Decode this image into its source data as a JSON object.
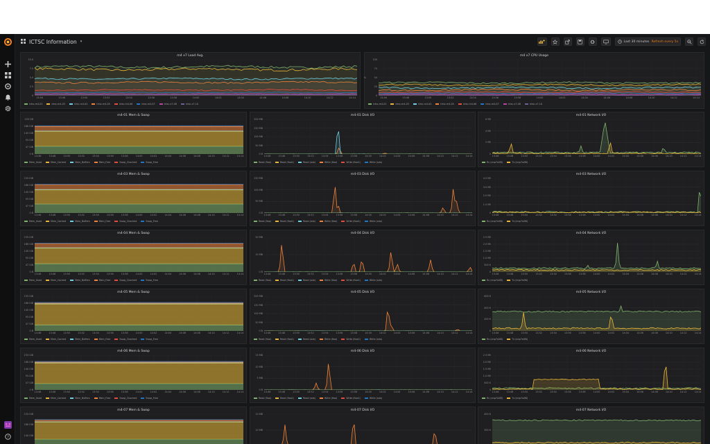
{
  "dashboard": {
    "title": "ICTSC Information"
  },
  "toolbar": {
    "time_range": "Last 30 minutes",
    "refresh": "Refresh every 5s"
  },
  "icons": {
    "logo": "grafana-logo-icon",
    "side": [
      "plus-icon",
      "dashboards-icon",
      "explore-icon",
      "alerts-icon",
      "gear-icon",
      "avatar-icon",
      "help-icon"
    ],
    "toolbar": [
      "add-panel-icon",
      "star-icon",
      "share-icon",
      "save-icon",
      "settings-icon",
      "tv-mode-icon",
      "clock-icon",
      "zoom-out-icon",
      "refresh-icon"
    ]
  },
  "time_ticks": [
    "13:46",
    "13:48",
    "13:50",
    "13:52",
    "13:54",
    "13:56",
    "13:58",
    "14:00",
    "14:02",
    "14:04",
    "14:06",
    "14:08",
    "14:10",
    "14:12",
    "14:14"
  ],
  "colors": {
    "green": "#7eb26d",
    "yellow": "#eab839",
    "cyan": "#6ed0e0",
    "orange": "#ef843c",
    "red": "#e24d42",
    "blue": "#1f78c1",
    "purple": "#ba43a9",
    "dkgreen": "#508642",
    "dkyellow": "#cca300",
    "dkblue": "#447ebc"
  },
  "panels": [
    {
      "id": "load",
      "title": "m4 x7 Load Avg.",
      "y_ticks": [
        "10.0",
        "7.5",
        "5.0",
        "2.5",
        "0"
      ],
      "chart_data": {
        "type": "line",
        "ylim": [
          0,
          10
        ],
        "x": "time_ticks",
        "series": [
          {
            "name": "ictsc-m4-01",
            "color": "#7eb26d",
            "level": 8.0,
            "noise": 0.3
          },
          {
            "name": "ictsc-m4-03",
            "color": "#eab839",
            "level": 7.3,
            "noise": 0.3
          },
          {
            "name": "ictsc-m4-04",
            "color": "#6ed0e0",
            "level": 4.7,
            "noise": 0.2
          },
          {
            "name": "ictsc-m4-05",
            "color": "#ef843c",
            "level": 3.7,
            "noise": 0.2
          },
          {
            "name": "ictsc-m4-06",
            "color": "#e24d42",
            "level": 1.6,
            "noise": 0.15
          },
          {
            "name": "ictsc-m4-07",
            "color": "#1f78c1",
            "level": 0.9,
            "noise": 0.1
          },
          {
            "name": "ictsc-x7-08",
            "color": "#ba43a9",
            "level": 0.5,
            "noise": 0.1
          },
          {
            "name": "ictsc-x7-10",
            "color": "#705da0",
            "level": 0.3,
            "noise": 0.05
          }
        ]
      }
    },
    {
      "id": "cpu",
      "title": "m4 x7 CPU Usage",
      "y_ticks": [
        "100",
        "75",
        "50",
        "25",
        "0"
      ],
      "y_unit": "%",
      "chart_data": {
        "type": "line",
        "ylim": [
          0,
          100
        ],
        "x": "time_ticks",
        "series": [
          {
            "name": "ictsc-m4-01",
            "color": "#7eb26d",
            "level": 36,
            "noise": 2
          },
          {
            "name": "ictsc-m4-03",
            "color": "#eab839",
            "level": 30,
            "noise": 2
          },
          {
            "name": "ictsc-m4-04",
            "color": "#6ed0e0",
            "level": 22,
            "noise": 2
          },
          {
            "name": "ictsc-m4-05",
            "color": "#ef843c",
            "level": 16,
            "noise": 2
          },
          {
            "name": "ictsc-m4-06",
            "color": "#e24d42",
            "level": 10,
            "noise": 1
          },
          {
            "name": "ictsc-m4-07",
            "color": "#1f78c1",
            "level": 7,
            "noise": 1
          },
          {
            "name": "ictsc-x7-08",
            "color": "#ba43a9",
            "level": 4,
            "noise": 1
          },
          {
            "name": "ictsc-x7-10",
            "color": "#705da0",
            "level": 2,
            "noise": 1
          }
        ]
      }
    },
    {
      "id": "mem01",
      "title": "m4-01 Mem & Swap",
      "kind": "mem",
      "y_ticks": [
        "233 GB",
        "186 GiB",
        "140 GiB",
        "93 GiB",
        "47 GiB",
        "0 B"
      ],
      "legend": [
        "Mem_Used",
        "Mem_Cached",
        "Mem_Buffers",
        "Mem_Free",
        "Swap_Chached",
        "Swap_Free"
      ],
      "chart_data": {
        "type": "area",
        "ylim": [
          0,
          233
        ],
        "stacked": true,
        "values": {
          "Mem_Used": 52,
          "Mem_Cached": 100,
          "Mem_Buffers": 3,
          "Mem_Free": 30
        }
      }
    },
    {
      "id": "disk01",
      "title": "m4-01 Disk I/O",
      "kind": "disk",
      "y_ticks": [
        "200 MB",
        "150 MB",
        "100 MB",
        "50 MB",
        "0 B"
      ],
      "legend": [
        "Read (fioa)",
        "Read (fioa1)",
        "Read (sda)",
        "Write (fioa)",
        "Write (fioa1)",
        "Write (sda)"
      ],
      "chart_data": {
        "type": "line",
        "ylim": [
          0,
          200
        ],
        "spikes": [
          {
            "t": 0.355,
            "v": 180,
            "color": "#6ed0e0"
          },
          {
            "t": 0.36,
            "v": 40,
            "color": "#ef843c"
          },
          {
            "t": 0.58,
            "v": 6,
            "color": "#ef843c"
          }
        ]
      }
    },
    {
      "id": "net01",
      "title": "m4-01 Network I/O",
      "kind": "net",
      "y_ticks": [
        "6 Mil",
        "4 Mil",
        "2 Mil",
        "0"
      ],
      "legend": [
        "Rx (enp7s0f0)",
        "Tx (enp7s0f0)"
      ],
      "chart_data": {
        "type": "area",
        "ylim": [
          0,
          6
        ],
        "base": [
          0.2,
          0.05
        ],
        "spikes": [
          {
            "t": 0.09,
            "v": 2.0,
            "color": "#eab839"
          },
          {
            "t": 0.425,
            "v": 1.4,
            "color": "#7eb26d"
          },
          {
            "t": 0.54,
            "v": 5.8,
            "color": "#7eb26d",
            "width": 0.025
          },
          {
            "t": 0.565,
            "v": 2.2,
            "color": "#eab839"
          },
          {
            "t": 0.82,
            "v": 1.3,
            "color": "#7eb26d"
          }
        ]
      }
    },
    {
      "id": "mem03",
      "title": "m4-03 Mem & Swap",
      "kind": "mem",
      "y_ticks": [
        "233 GiB",
        "186 GiB",
        "140 GiB",
        "93 GiB",
        "47 GiB",
        "0 B"
      ],
      "legend": [
        "Mem_Used",
        "Mem_Cached",
        "Mem_Buffers",
        "Mem_Free",
        "Swap_Chached",
        "Swap_Free"
      ],
      "chart_data": {
        "type": "area",
        "ylim": [
          0,
          233
        ],
        "stacked": true,
        "values": {
          "Mem_Used": 60,
          "Mem_Cached": 95,
          "Mem_Buffers": 3,
          "Mem_Free": 30
        }
      }
    },
    {
      "id": "disk03",
      "title": "m4-03 Disk I/O",
      "kind": "disk",
      "y_ticks": [
        "150 MB",
        "100 MB",
        "50 MB",
        "0 B"
      ],
      "legend": [
        "Read (fioa)",
        "Read (fioa1)",
        "Read (sda)",
        "Write (fioa)",
        "Write (fioa1)",
        "Write (sda)"
      ],
      "chart_data": {
        "type": "line",
        "ylim": [
          0,
          150
        ],
        "spikes": [
          {
            "t": 0.34,
            "v": 130,
            "color": "#ef843c"
          },
          {
            "t": 0.355,
            "v": 40,
            "color": "#ef843c"
          },
          {
            "t": 0.86,
            "v": 25,
            "color": "#ef843c"
          },
          {
            "t": 0.91,
            "v": 120,
            "color": "#ef843c"
          },
          {
            "t": 0.925,
            "v": 50,
            "color": "#ef843c"
          }
        ]
      }
    },
    {
      "id": "net03",
      "title": "m4-03 Network I/O",
      "kind": "net",
      "y_ticks": [
        "4.0 Mil",
        "3.0 Mil",
        "2.0 Mil",
        "1.0 Mil",
        "0"
      ],
      "legend": [
        "Rx (enp7s0f0)",
        "Tx (enp7s0f0)"
      ],
      "chart_data": {
        "type": "line",
        "ylim": [
          0,
          4
        ],
        "base": [
          0.08,
          0.05
        ],
        "spikes": [
          {
            "t": 0.995,
            "v": 3.3,
            "color": "#7eb26d"
          }
        ]
      }
    },
    {
      "id": "mem04",
      "title": "m4-04 Mem & Swap",
      "kind": "mem",
      "y_ticks": [
        "233 GiB",
        "186 GiB",
        "140 GiB",
        "93 GiB",
        "47 GiB",
        "0 B"
      ],
      "legend": [
        "Mem_Used",
        "Mem_Cached",
        "Mem_Buffers",
        "Mem_Free",
        "Swap_Chached",
        "Swap_Free"
      ],
      "chart_data": {
        "type": "area",
        "ylim": [
          0,
          233
        ],
        "stacked": true,
        "values": {
          "Mem_Used": 55,
          "Mem_Cached": 105,
          "Mem_Buffers": 3,
          "Mem_Free": 25
        }
      }
    },
    {
      "id": "disk04",
      "title": "m4-04 Disk I/O",
      "kind": "disk",
      "y_ticks": [
        "20 MB",
        "10 MB",
        "0 B"
      ],
      "legend": [
        "Read (fioa)",
        "Read (fioa1)",
        "Read (sda)",
        "Write (fioa)",
        "Write (fioa1)",
        "Write (sda)"
      ],
      "chart_data": {
        "type": "line",
        "ylim": [
          0,
          20
        ],
        "spikes": [
          {
            "t": 0.085,
            "v": 18,
            "color": "#ef843c"
          },
          {
            "t": 0.43,
            "v": 6,
            "color": "#ef843c"
          },
          {
            "t": 0.47,
            "v": 8,
            "color": "#ef843c"
          },
          {
            "t": 0.61,
            "v": 13,
            "color": "#ef843c"
          },
          {
            "t": 0.64,
            "v": 5,
            "color": "#ef843c"
          },
          {
            "t": 0.8,
            "v": 7,
            "color": "#ef843c"
          },
          {
            "t": 0.99,
            "v": 3,
            "color": "#ef843c"
          }
        ]
      }
    },
    {
      "id": "net04",
      "title": "m4-04 Network I/O",
      "kind": "net",
      "y_ticks": [
        "2.5 Mil",
        "2.0 Mil",
        "1.5 Mil",
        "1.0 Mil",
        "500 K",
        "0"
      ],
      "legend": [
        "Rx (enp7s0f0)",
        "Tx (enp7s0f0)"
      ],
      "chart_data": {
        "type": "area",
        "ylim": [
          0,
          2.5
        ],
        "base": [
          0.25,
          0.12
        ],
        "spikes": [
          {
            "t": 0.6,
            "v": 2.1,
            "color": "#7eb26d"
          },
          {
            "t": 0.79,
            "v": 0.9,
            "color": "#7eb26d"
          },
          {
            "t": 0.46,
            "v": 0.55,
            "color": "#7eb26d"
          }
        ]
      }
    },
    {
      "id": "mem05",
      "title": "m4-05 Mem & Swap",
      "kind": "mem",
      "y_ticks": [
        "233 GiB",
        "186 GiB",
        "140 GiB",
        "93 GiB",
        "47 GiB",
        "0 B"
      ],
      "legend": [
        "Mem_Used",
        "Mem_Cached",
        "Mem_Buffers",
        "Mem_Free",
        "Swap_Chached",
        "Swap_Free"
      ],
      "chart_data": {
        "type": "area",
        "ylim": [
          0,
          233
        ],
        "stacked": true,
        "values": {
          "Mem_Used": 40,
          "Mem_Cached": 140,
          "Mem_Buffers": 3,
          "Mem_Free": 3
        }
      }
    },
    {
      "id": "disk05",
      "title": "m4-05 Disk I/O",
      "kind": "disk",
      "y_ticks": [
        "200 MB",
        "150 MB",
        "100 MB",
        "50 MB",
        "0 B"
      ],
      "legend": [
        "Read (fioa)",
        "Read (fioa1)",
        "Read (sda)",
        "Write (fioa)",
        "Write (fioa1)",
        "Write (sda)"
      ],
      "chart_data": {
        "type": "line",
        "ylim": [
          0,
          200
        ],
        "spikes": [
          {
            "t": 0.595,
            "v": 150,
            "color": "#ef843c"
          },
          {
            "t": 0.61,
            "v": 40,
            "color": "#ef843c"
          },
          {
            "t": 0.93,
            "v": 10,
            "color": "#ef843c"
          }
        ]
      }
    },
    {
      "id": "net05",
      "title": "m4-05 Network I/O",
      "kind": "net",
      "y_ticks": [
        "600 K",
        "400 K",
        "200 K",
        "0"
      ],
      "legend": [
        "Rx (enp7s0f0)",
        "Tx (enp7s0f0)"
      ],
      "chart_data": {
        "type": "area",
        "ylim": [
          0,
          600
        ],
        "base": [
          330,
          40
        ],
        "spikes": [
          {
            "t": 0.15,
            "v": 320,
            "color": "#eab839"
          },
          {
            "t": 0.57,
            "v": 330,
            "color": "#eab839"
          },
          {
            "t": 0.615,
            "v": 500,
            "color": "#7eb26d"
          },
          {
            "t": 0.72,
            "v": 430,
            "color": "#7eb26d"
          }
        ]
      }
    },
    {
      "id": "mem06",
      "title": "m4-06 Mem & Swap",
      "kind": "mem",
      "y_ticks": [
        "233 GiB",
        "186 GiB",
        "140 GiB",
        "93 GiB",
        "47 GiB",
        "0 B"
      ],
      "legend": [
        "Mem_Used",
        "Mem_Cached",
        "Mem_Buffers",
        "Mem_Free",
        "Swap_Chached",
        "Swap_Free"
      ],
      "chart_data": {
        "type": "area",
        "ylim": [
          0,
          233
        ],
        "stacked": true,
        "values": {
          "Mem_Used": 42,
          "Mem_Cached": 138,
          "Mem_Buffers": 3,
          "Mem_Free": 3
        }
      }
    },
    {
      "id": "disk06",
      "title": "m4-06 Disk I/O",
      "kind": "disk",
      "y_ticks": [
        "15 MB",
        "10 MB",
        "5 MB",
        "0 B"
      ],
      "legend": [
        "Read (fioa)",
        "Read (fioa1)",
        "Read (sda)",
        "Write (fioa)",
        "Write (fioa1)",
        "Write (sda)"
      ],
      "chart_data": {
        "type": "line",
        "ylim": [
          0,
          15
        ],
        "spikes": [
          {
            "t": 0.25,
            "v": 3,
            "color": "#ef843c"
          },
          {
            "t": 0.31,
            "v": 13,
            "color": "#ef843c"
          }
        ]
      }
    },
    {
      "id": "net06",
      "title": "m4-06 Network I/O",
      "kind": "net",
      "y_ticks": [
        "2.5 Mil",
        "2.0 Mil",
        "1.5 Mil",
        "1.0 Mil",
        "500 K",
        "0"
      ],
      "legend": [
        "Rx (enp7s0f0)",
        "Tx (enp7s0f0)"
      ],
      "chart_data": {
        "type": "area",
        "ylim": [
          0,
          2.5
        ],
        "base": [
          0.1,
          0.05
        ],
        "plateau": {
          "from": 0.2,
          "to": 0.51,
          "v": 0.75,
          "color": "#eab839"
        },
        "spikes": [
          {
            "t": 0.83,
            "v": 2.3,
            "color": "#eab839"
          }
        ]
      }
    },
    {
      "id": "mem07",
      "title": "m4-07 Mem & Swap",
      "kind": "mem",
      "y_ticks": [
        "233 GiB",
        "186 GiB",
        "140 GiB",
        "93 GiB"
      ],
      "legend": [],
      "chart_data": {
        "type": "area",
        "ylim": [
          0,
          233
        ],
        "stacked": true,
        "values": {
          "Mem_Used": 50,
          "Mem_Cached": 125,
          "Mem_Buffers": 3,
          "Mem_Free": 10
        }
      }
    },
    {
      "id": "disk07",
      "title": "m4-07 Disk I/O",
      "kind": "disk",
      "y_ticks": [
        "15 MB",
        "10 MB",
        "5 MB"
      ],
      "legend": [],
      "chart_data": {
        "type": "line",
        "ylim": [
          0,
          15
        ],
        "spikes": [
          {
            "t": 0.1,
            "v": 10,
            "color": "#ef843c"
          },
          {
            "t": 0.43,
            "v": 14,
            "color": "#ef843c"
          },
          {
            "t": 0.82,
            "v": 8,
            "color": "#ef843c"
          }
        ]
      }
    },
    {
      "id": "net07",
      "title": "m4-07 Network I/O",
      "kind": "net",
      "y_ticks": [
        "400 K",
        "300 K",
        "200 K"
      ],
      "legend": [],
      "chart_data": {
        "type": "area",
        "ylim": [
          0,
          400
        ],
        "base": [
          320,
          40
        ],
        "spikes": []
      }
    }
  ]
}
